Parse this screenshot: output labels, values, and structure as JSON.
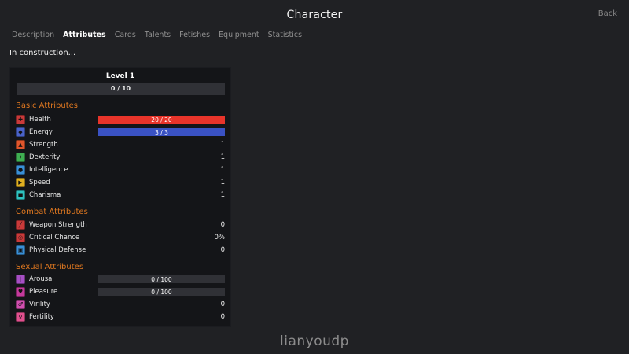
{
  "header": {
    "title": "Character",
    "back_label": "Back"
  },
  "tabs": [
    {
      "label": "Description"
    },
    {
      "label": "Attributes",
      "active": true
    },
    {
      "label": "Cards"
    },
    {
      "label": "Talents"
    },
    {
      "label": "Fetishes"
    },
    {
      "label": "Equipment"
    },
    {
      "label": "Statistics"
    }
  ],
  "notice": "In construction...",
  "level": {
    "label": "Level 1",
    "xp_text": "0 / 10",
    "xp_fraction": 0
  },
  "basic": {
    "title": "Basic Attributes",
    "health": {
      "label": "Health",
      "bar_text": "20 / 20",
      "fraction": 1.0,
      "color": "#e8342a",
      "icon": "health-icon",
      "icon_color": "#c93a3a"
    },
    "energy": {
      "label": "Energy",
      "bar_text": "3 / 3",
      "fraction": 1.0,
      "color": "#3a52c4",
      "icon": "energy-icon",
      "icon_color": "#4a63c9"
    },
    "strength": {
      "label": "Strength",
      "value": "1",
      "icon": "strength-icon",
      "icon_color": "#e0562c"
    },
    "dexterity": {
      "label": "Dexterity",
      "value": "1",
      "icon": "dexterity-icon",
      "icon_color": "#3fae52"
    },
    "intelligence": {
      "label": "Intelligence",
      "value": "1",
      "icon": "intelligence-icon",
      "icon_color": "#3a8fd6"
    },
    "speed": {
      "label": "Speed",
      "value": "1",
      "icon": "speed-icon",
      "icon_color": "#e0b021"
    },
    "charisma": {
      "label": "Charisma",
      "value": "1",
      "icon": "charisma-icon",
      "icon_color": "#2fc2c0"
    }
  },
  "combat": {
    "title": "Combat Attributes",
    "weapon_strength": {
      "label": "Weapon Strength",
      "value": "0",
      "icon": "weapon-strength-icon",
      "icon_color": "#c93a3a"
    },
    "critical_chance": {
      "label": "Critical Chance",
      "value": "0%",
      "icon": "critical-chance-icon",
      "icon_color": "#c93a3a"
    },
    "physical_defense": {
      "label": "Physical Defense",
      "value": "0",
      "icon": "physical-defense-icon",
      "icon_color": "#3a8fd6"
    }
  },
  "sexual": {
    "title": "Sexual Attributes",
    "arousal": {
      "label": "Arousal",
      "bar_text": "0 / 100",
      "fraction": 0,
      "color": "#c03ca0",
      "icon": "arousal-icon",
      "icon_color": "#a64fc4"
    },
    "pleasure": {
      "label": "Pleasure",
      "bar_text": "0 / 100",
      "fraction": 0,
      "color": "#d04a8a",
      "icon": "pleasure-icon",
      "icon_color": "#c43a9c"
    },
    "virility": {
      "label": "Virility",
      "value": "0",
      "icon": "virility-icon",
      "icon_color": "#d24fb0"
    },
    "fertility": {
      "label": "Fertility",
      "value": "0",
      "icon": "fertility-icon",
      "icon_color": "#e0508e"
    }
  },
  "watermark": "lianyoudp"
}
